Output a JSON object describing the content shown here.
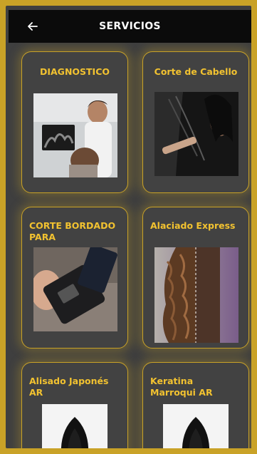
{
  "header": {
    "back_icon": "back-arrow-icon",
    "title": "SERVICIOS"
  },
  "services": [
    {
      "label": "DIAGNOSTICO"
    },
    {
      "label": "Corte de Cabello"
    },
    {
      "label": "CORTE BORDADO PARA"
    },
    {
      "label": "Alaciado Express"
    },
    {
      "label": "Alisado Japonés AR"
    },
    {
      "label": "Keratina Marroqui AR"
    }
  ],
  "colors": {
    "accent": "#c9a227",
    "label": "#f2c230",
    "appbar": "#0b0b0b",
    "card": "#424242",
    "background": "#3f3f3f"
  }
}
